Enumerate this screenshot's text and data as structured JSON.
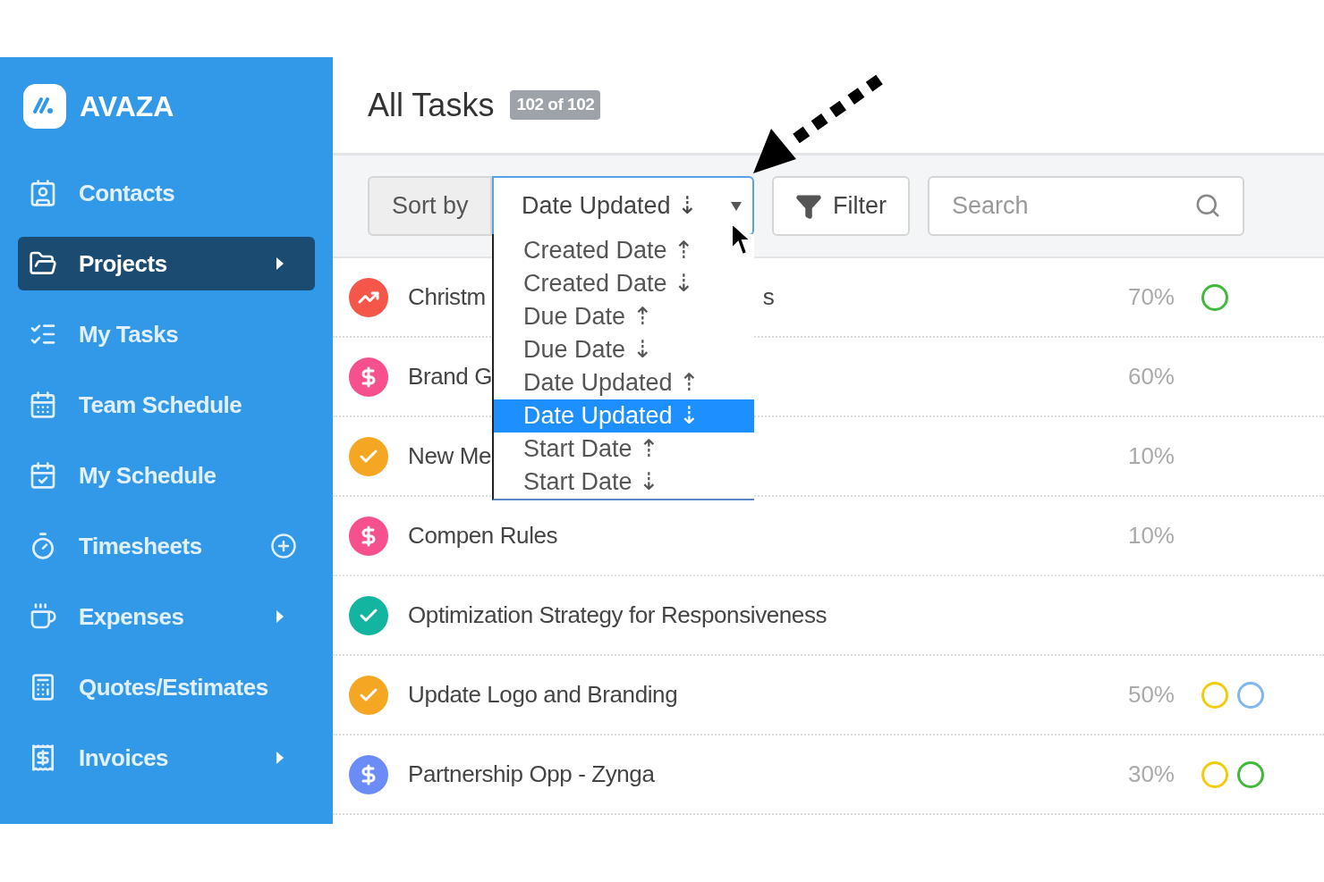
{
  "sidebar": {
    "brand": "AVAZA",
    "items": [
      {
        "label": "Contacts",
        "selected": false
      },
      {
        "label": "Projects",
        "selected": true,
        "has_submenu": true
      },
      {
        "label": "My Tasks",
        "selected": false
      },
      {
        "label": "Team Schedule",
        "selected": false
      },
      {
        "label": "My Schedule",
        "selected": false
      },
      {
        "label": "Timesheets",
        "selected": false,
        "has_add": true
      },
      {
        "label": "Expenses",
        "selected": false,
        "has_submenu": true
      },
      {
        "label": "Quotes/Estimates",
        "selected": false
      },
      {
        "label": "Invoices",
        "selected": false,
        "has_submenu": true
      }
    ]
  },
  "header": {
    "title": "All Tasks",
    "count": "102 of 102"
  },
  "toolbar": {
    "sort_label": "Sort by",
    "sort_value": "Date Updated ⇣",
    "sort_expanded": true,
    "sort_options": [
      {
        "label": "Created Date ⇡",
        "selected": false
      },
      {
        "label": "Created Date ⇣",
        "selected": false
      },
      {
        "label": "Due Date ⇡",
        "selected": false
      },
      {
        "label": "Due Date ⇣",
        "selected": false
      },
      {
        "label": "Date Updated ⇡",
        "selected": false
      },
      {
        "label": "Date Updated ⇣",
        "selected": true
      },
      {
        "label": "Start Date ⇡",
        "selected": false
      },
      {
        "label": "Start Date ⇣",
        "selected": false
      }
    ],
    "filter": "Filter",
    "search": {
      "placeholder": "Search"
    }
  },
  "tasks": [
    {
      "kind": "chart",
      "color": "#f4574a",
      "name": "Christm",
      "name_tail": "s",
      "percent": "70%",
      "markers": [
        {
          "color": "#3fba3a"
        }
      ]
    },
    {
      "kind": "dollar",
      "color": "#f6508f",
      "name": "Brand G",
      "percent": "60%"
    },
    {
      "kind": "check",
      "color": "#f5a623",
      "name": "New Me",
      "percent": "10%"
    },
    {
      "kind": "dollar",
      "color": "#f6508f",
      "name": "Compen Rules",
      "percent": "10%"
    },
    {
      "kind": "check",
      "color": "#13b5a1",
      "name": "Optimization Strategy for Responsiveness"
    },
    {
      "kind": "check",
      "color": "#f5a623",
      "name": "Update Logo and Branding",
      "percent": "50%",
      "markers": [
        {
          "color": "#f2cc0c"
        },
        {
          "color": "#7fb6ef"
        }
      ]
    },
    {
      "kind": "dollar",
      "color": "#6b8cf7",
      "name": "Partnership Opp - Zynga",
      "percent": "30%",
      "markers": [
        {
          "color": "#f2cc0c"
        },
        {
          "color": "#3fba3a"
        }
      ]
    }
  ]
}
